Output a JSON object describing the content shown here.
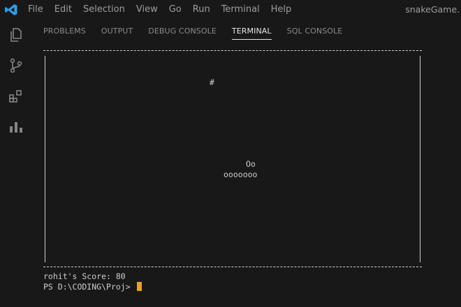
{
  "menu": [
    "File",
    "Edit",
    "Selection",
    "View",
    "Go",
    "Run",
    "Terminal",
    "Help"
  ],
  "window_title": "snakeGame.",
  "activity_icons": [
    "explorer-icon",
    "source-control-icon",
    "extensions-icon",
    "chart-icon"
  ],
  "tabs": [
    "PROBLEMS",
    "OUTPUT",
    "DEBUG CONSOLE",
    "TERMINAL",
    "SQL CONSOLE"
  ],
  "active_tab": "TERMINAL",
  "terminal": {
    "food": "#",
    "snake_head": "Oo",
    "snake_body": "ooooooo",
    "score_line": "rohit's Score: 80",
    "prompt": "PS D:\\CODING\\Proj>"
  },
  "colors": {
    "background": "#181818",
    "accent_logo": "#2f9ee6",
    "cursor": "#e8a317"
  }
}
